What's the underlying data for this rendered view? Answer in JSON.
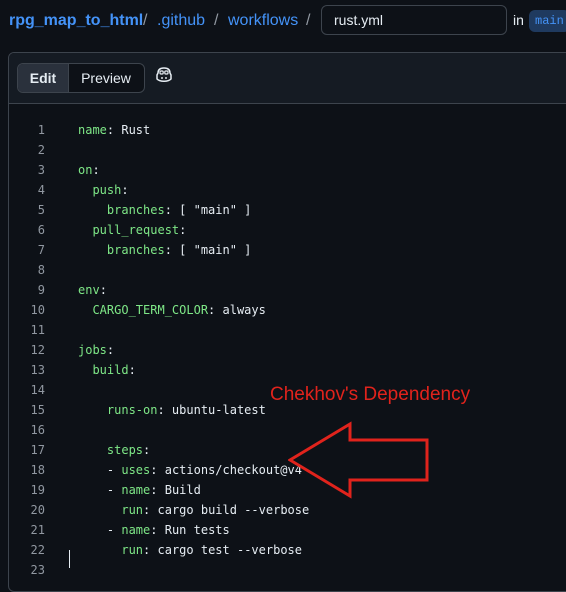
{
  "breadcrumb": {
    "repo": "rpg_map_to_html",
    "separator": "/",
    "folder1": ".github",
    "folder2": "workflows"
  },
  "file": {
    "name": "rust.yml",
    "in_label": "in",
    "branch": "main"
  },
  "editor": {
    "tabs": {
      "edit": "Edit",
      "preview": "Preview"
    },
    "copilot_icon": "copilot-icon"
  },
  "code_lines": [
    {
      "n": "1",
      "tokens": [
        {
          "t": "name",
          "c": "k"
        },
        {
          "t": ": Rust",
          "c": "v"
        }
      ]
    },
    {
      "n": "2",
      "tokens": []
    },
    {
      "n": "3",
      "tokens": [
        {
          "t": "on",
          "c": "k"
        },
        {
          "t": ":",
          "c": "p"
        }
      ]
    },
    {
      "n": "4",
      "tokens": [
        {
          "t": "  ",
          "c": "p"
        },
        {
          "t": "push",
          "c": "k"
        },
        {
          "t": ":",
          "c": "p"
        }
      ]
    },
    {
      "n": "5",
      "tokens": [
        {
          "t": "    ",
          "c": "p"
        },
        {
          "t": "branches",
          "c": "k"
        },
        {
          "t": ": [ \"main\" ]",
          "c": "v"
        }
      ]
    },
    {
      "n": "6",
      "tokens": [
        {
          "t": "  ",
          "c": "p"
        },
        {
          "t": "pull_request",
          "c": "k"
        },
        {
          "t": ":",
          "c": "p"
        }
      ]
    },
    {
      "n": "7",
      "tokens": [
        {
          "t": "    ",
          "c": "p"
        },
        {
          "t": "branches",
          "c": "k"
        },
        {
          "t": ": [ \"main\" ]",
          "c": "v"
        }
      ]
    },
    {
      "n": "8",
      "tokens": []
    },
    {
      "n": "9",
      "tokens": [
        {
          "t": "env",
          "c": "k"
        },
        {
          "t": ":",
          "c": "p"
        }
      ]
    },
    {
      "n": "10",
      "tokens": [
        {
          "t": "  ",
          "c": "p"
        },
        {
          "t": "CARGO_TERM_COLOR",
          "c": "k"
        },
        {
          "t": ": always",
          "c": "v"
        }
      ]
    },
    {
      "n": "11",
      "tokens": []
    },
    {
      "n": "12",
      "tokens": [
        {
          "t": "jobs",
          "c": "k"
        },
        {
          "t": ":",
          "c": "p"
        }
      ]
    },
    {
      "n": "13",
      "tokens": [
        {
          "t": "  ",
          "c": "p"
        },
        {
          "t": "build",
          "c": "k"
        },
        {
          "t": ":",
          "c": "p"
        }
      ]
    },
    {
      "n": "14",
      "tokens": []
    },
    {
      "n": "15",
      "tokens": [
        {
          "t": "    ",
          "c": "p"
        },
        {
          "t": "runs-on",
          "c": "k"
        },
        {
          "t": ": ubuntu-latest",
          "c": "v"
        }
      ]
    },
    {
      "n": "16",
      "tokens": []
    },
    {
      "n": "17",
      "tokens": [
        {
          "t": "    ",
          "c": "p"
        },
        {
          "t": "steps",
          "c": "k"
        },
        {
          "t": ":",
          "c": "p"
        }
      ]
    },
    {
      "n": "18",
      "tokens": [
        {
          "t": "    - ",
          "c": "p"
        },
        {
          "t": "uses",
          "c": "k"
        },
        {
          "t": ": actions/checkout@v4",
          "c": "v"
        }
      ]
    },
    {
      "n": "19",
      "tokens": [
        {
          "t": "    - ",
          "c": "p"
        },
        {
          "t": "name",
          "c": "k"
        },
        {
          "t": ": Build",
          "c": "v"
        }
      ]
    },
    {
      "n": "20",
      "tokens": [
        {
          "t": "      ",
          "c": "p"
        },
        {
          "t": "run",
          "c": "k"
        },
        {
          "t": ": cargo build --verbose",
          "c": "v"
        }
      ]
    },
    {
      "n": "21",
      "tokens": [
        {
          "t": "    - ",
          "c": "p"
        },
        {
          "t": "name",
          "c": "k"
        },
        {
          "t": ": Run tests",
          "c": "v"
        }
      ]
    },
    {
      "n": "22",
      "tokens": [
        {
          "t": "      ",
          "c": "p"
        },
        {
          "t": "run",
          "c": "k"
        },
        {
          "t": ": cargo test --verbose",
          "c": "v"
        }
      ]
    },
    {
      "n": "23",
      "tokens": []
    }
  ],
  "annotation": {
    "text": "Chekhov's Dependency",
    "color": "#e0231c",
    "arrow_icon": "left-arrow-icon"
  },
  "colors": {
    "background": "#0d1117",
    "link": "#4493f8",
    "yaml_key": "#7ee787",
    "text": "#e6edf3",
    "line_number": "#9198a1"
  }
}
